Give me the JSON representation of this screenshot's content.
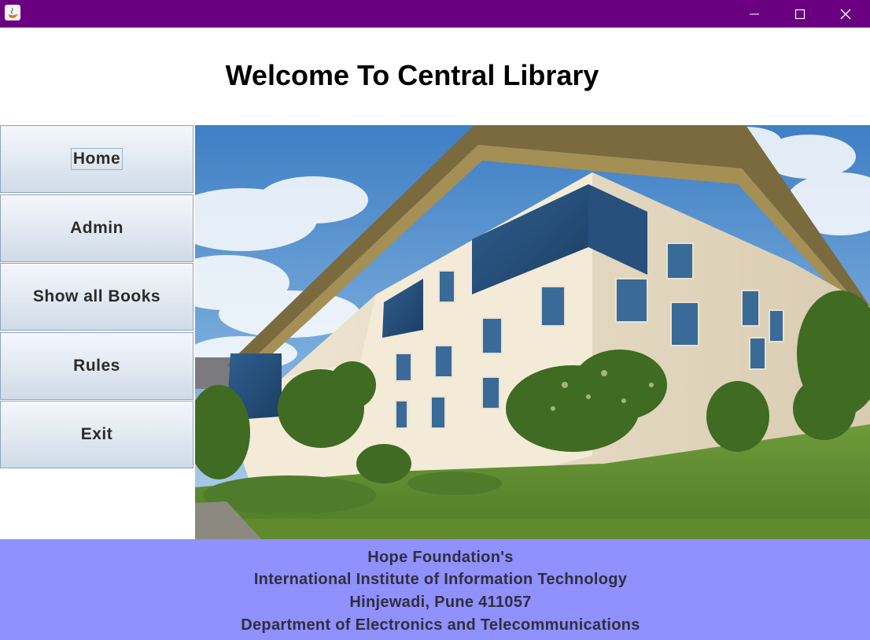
{
  "window": {
    "controls": {
      "minimize_icon": "minimize-icon",
      "maximize_icon": "maximize-icon",
      "close_icon": "close-icon"
    },
    "titlebar_color": "#6a0080"
  },
  "header": {
    "title": "Welcome To Central Library"
  },
  "sidebar": {
    "items": [
      {
        "label": "Home",
        "focused": true
      },
      {
        "label": "Admin"
      },
      {
        "label": "Show all Books"
      },
      {
        "label": "Rules"
      },
      {
        "label": "Exit"
      }
    ]
  },
  "main": {
    "image": "library-building-photo"
  },
  "footer": {
    "background": "#9090ff",
    "lines": [
      "Hope Foundation's",
      "International Institute of Information Technology",
      "Hinjewadi, Pune 411057",
      "Department of Electronics and Telecommunications"
    ]
  }
}
